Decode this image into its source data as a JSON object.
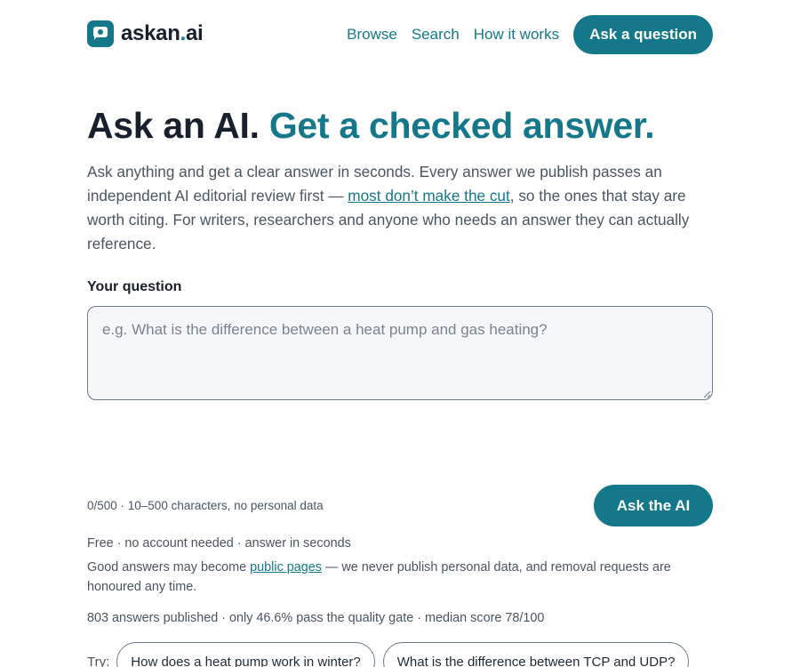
{
  "header": {
    "logo_text_main": "askan",
    "logo_text_dot": ".",
    "logo_text_tld": "ai",
    "nav": [
      {
        "label": "Browse"
      },
      {
        "label": "Search"
      },
      {
        "label": "How it works"
      }
    ],
    "cta_label": "Ask a question"
  },
  "hero": {
    "title_plain": "Ask an AI.",
    "title_accent": "Get a checked answer.",
    "intro_before": "Ask anything and get a clear answer in seconds. Every answer we publish passes an independent AI editorial review first — ",
    "intro_link": "most don’t make the cut",
    "intro_after": ", so the ones that stay are worth citing. For writers, researchers and anyone who needs an answer they can actually reference."
  },
  "form": {
    "label": "Your question",
    "placeholder": "e.g. What is the difference between a heat pump and gas heating?",
    "value": "",
    "counter": "0/500 · 10–500 characters, no personal data",
    "submit_label": "Ask the AI"
  },
  "meta": {
    "free_line": "Free · no account needed · answer in seconds",
    "publish_before": "Good answers may become ",
    "publish_link": "public pages",
    "publish_after": " — we never publish personal data, and removal requests are honoured any time.",
    "stats": "803 answers published · only 46.6% pass the quality gate · median score 78/100"
  },
  "suggestions": {
    "label": "Try:",
    "items": [
      "How does a heat pump work in winter?",
      "What is the difference between TCP and UDP?"
    ]
  },
  "colors": {
    "brand": "#14788a",
    "heading": "#17202c",
    "body_text": "#4a5563"
  }
}
